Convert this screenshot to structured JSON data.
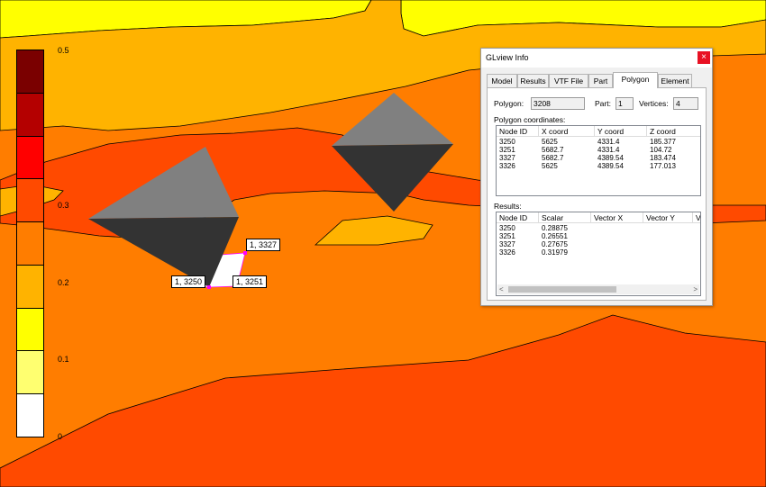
{
  "legend": {
    "ticks": [
      "0.5",
      "0.3",
      "0.2",
      "0.1",
      "0"
    ],
    "bands": [
      "#7a0000",
      "#b40000",
      "#ff0000",
      "#ff4a00",
      "#ff7d00",
      "#ffb300",
      "#ffff00",
      "#ffff70",
      "#ffffff"
    ]
  },
  "node_labels": [
    "1, 3327",
    "1, 3250",
    "1, 3251"
  ],
  "colors": {
    "contour_line": "#000000",
    "selection_marker": "#ff00ff",
    "pyramid_light": "#808080",
    "pyramid_dark": "#333333"
  },
  "dialog": {
    "title": "GLview Info",
    "close": "×",
    "tabs": [
      "Model",
      "Results",
      "VTF File",
      "Part",
      "Polygon",
      "Element"
    ],
    "active_tab": "Polygon",
    "polygon_label": "Polygon:",
    "polygon_value": "3208",
    "part_label": "Part:",
    "part_value": "1",
    "vertices_label": "Vertices:",
    "vertices_value": "4",
    "coords_header": "Polygon coordinates:",
    "coords_columns": [
      "Node ID",
      "X coord",
      "Y coord",
      "Z coord"
    ],
    "coords_rows": [
      [
        "3250",
        "5625",
        "4331.4",
        "185.377"
      ],
      [
        "3251",
        "5682.7",
        "4331.4",
        "104.72"
      ],
      [
        "3327",
        "5682.7",
        "4389.54",
        "183.474"
      ],
      [
        "3326",
        "5625",
        "4389.54",
        "177.013"
      ]
    ],
    "results_header": "Results:",
    "results_columns": [
      "Node ID",
      "Scalar",
      "Vector X",
      "Vector Y",
      "V"
    ],
    "results_rows": [
      [
        "3250",
        "0.28875"
      ],
      [
        "3251",
        "0.26551"
      ],
      [
        "3327",
        "0.27675"
      ],
      [
        "3326",
        "0.31979"
      ]
    ],
    "scroll_left": "<",
    "scroll_right": ">"
  }
}
